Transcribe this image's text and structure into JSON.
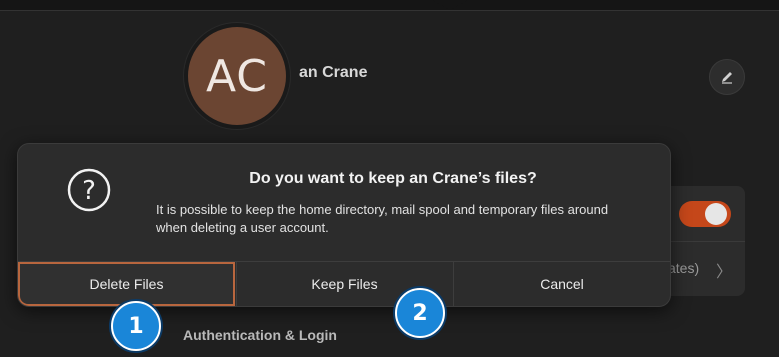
{
  "user": {
    "initials": "AC",
    "name": "an Crane",
    "avatar_color": "#6b4532"
  },
  "background": {
    "updates_text": "ates)",
    "chevron": "〉",
    "section_title": "Authentication & Login",
    "toggle_color": "#c5471a"
  },
  "dialog": {
    "icon": "question-circle-icon",
    "title": "Do you want to keep an Crane’s files?",
    "body": "It is possible to keep the home directory, mail spool and temporary files around when deleting a user account.",
    "buttons": {
      "delete": "Delete Files",
      "keep": "Keep Files",
      "cancel": "Cancel"
    },
    "focus_color": "#b8663e"
  },
  "annotations": {
    "badge_1": "1",
    "badge_2": "2",
    "badge_color": "#1a86d8"
  }
}
